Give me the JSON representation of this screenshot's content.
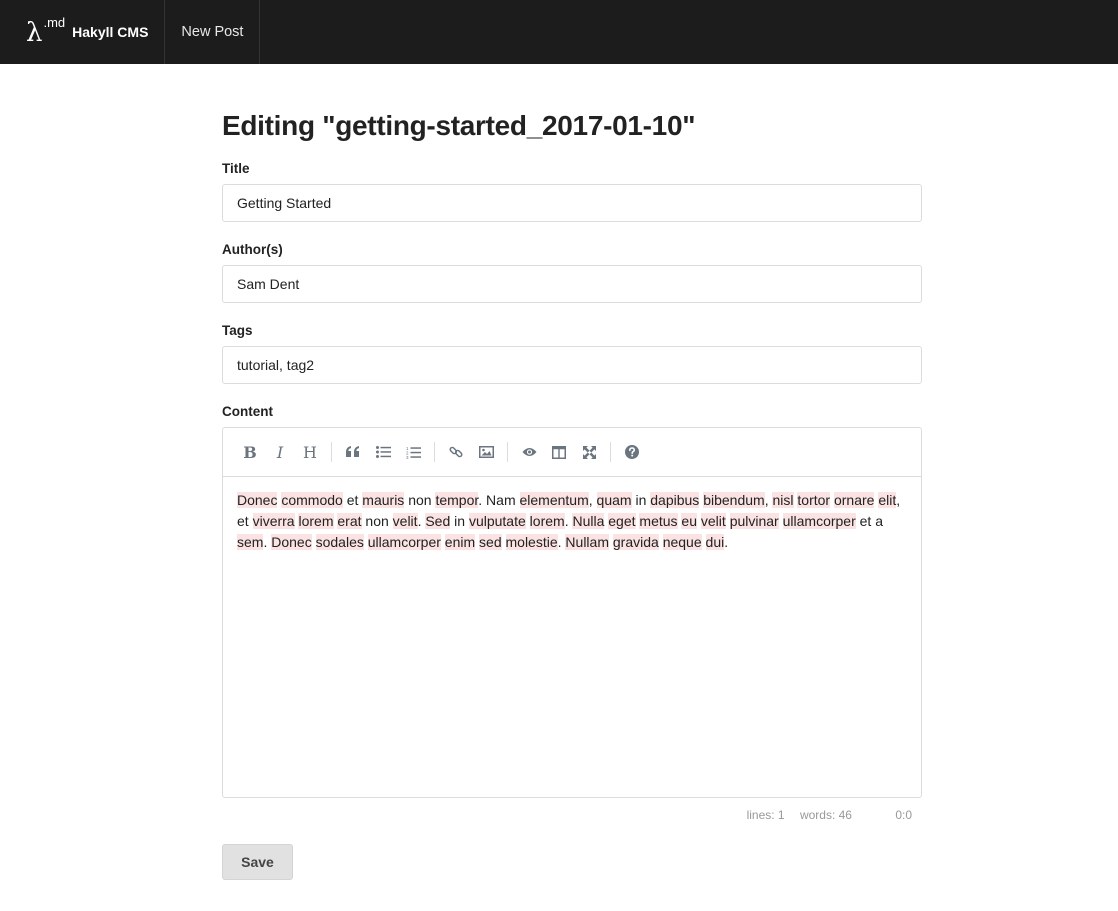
{
  "nav": {
    "logo_symbol": "λ",
    "logo_sup": ".md",
    "brand": "Hakyll CMS",
    "new_post": "New Post"
  },
  "page": {
    "heading": "Editing \"getting-started_2017-01-10\""
  },
  "form": {
    "title_label": "Title",
    "title_value": "Getting Started",
    "authors_label": "Author(s)",
    "authors_value": "Sam Dent",
    "tags_label": "Tags",
    "tags_value": "tutorial, tag2",
    "content_label": "Content",
    "content_text": "Donec commodo et mauris non tempor. Nam elementum, quam in dapibus bibendum, nisl tortor ornare elit, et viverra lorem erat non velit. Sed in vulputate lorem. Nulla eget metus eu velit pulvinar ullamcorper et a sem. Donec sodales ullamcorper enim sed molestie. Nullam gravida neque dui.",
    "save_label": "Save"
  },
  "toolbar": {
    "bold": "B",
    "italic": "I",
    "heading": "H",
    "icons": [
      "quote-icon",
      "unordered-list-icon",
      "ordered-list-icon",
      "link-icon",
      "image-icon",
      "preview-icon",
      "side-by-side-icon",
      "fullscreen-icon",
      "help-icon"
    ]
  },
  "status": {
    "lines": "lines: 1",
    "words": "words: 46",
    "cursor": "0:0"
  },
  "colors": {
    "navbar_bg": "#1c1c1c",
    "spell_highlight": "#fbe3e3",
    "toolbar_icon": "#6b7580"
  }
}
